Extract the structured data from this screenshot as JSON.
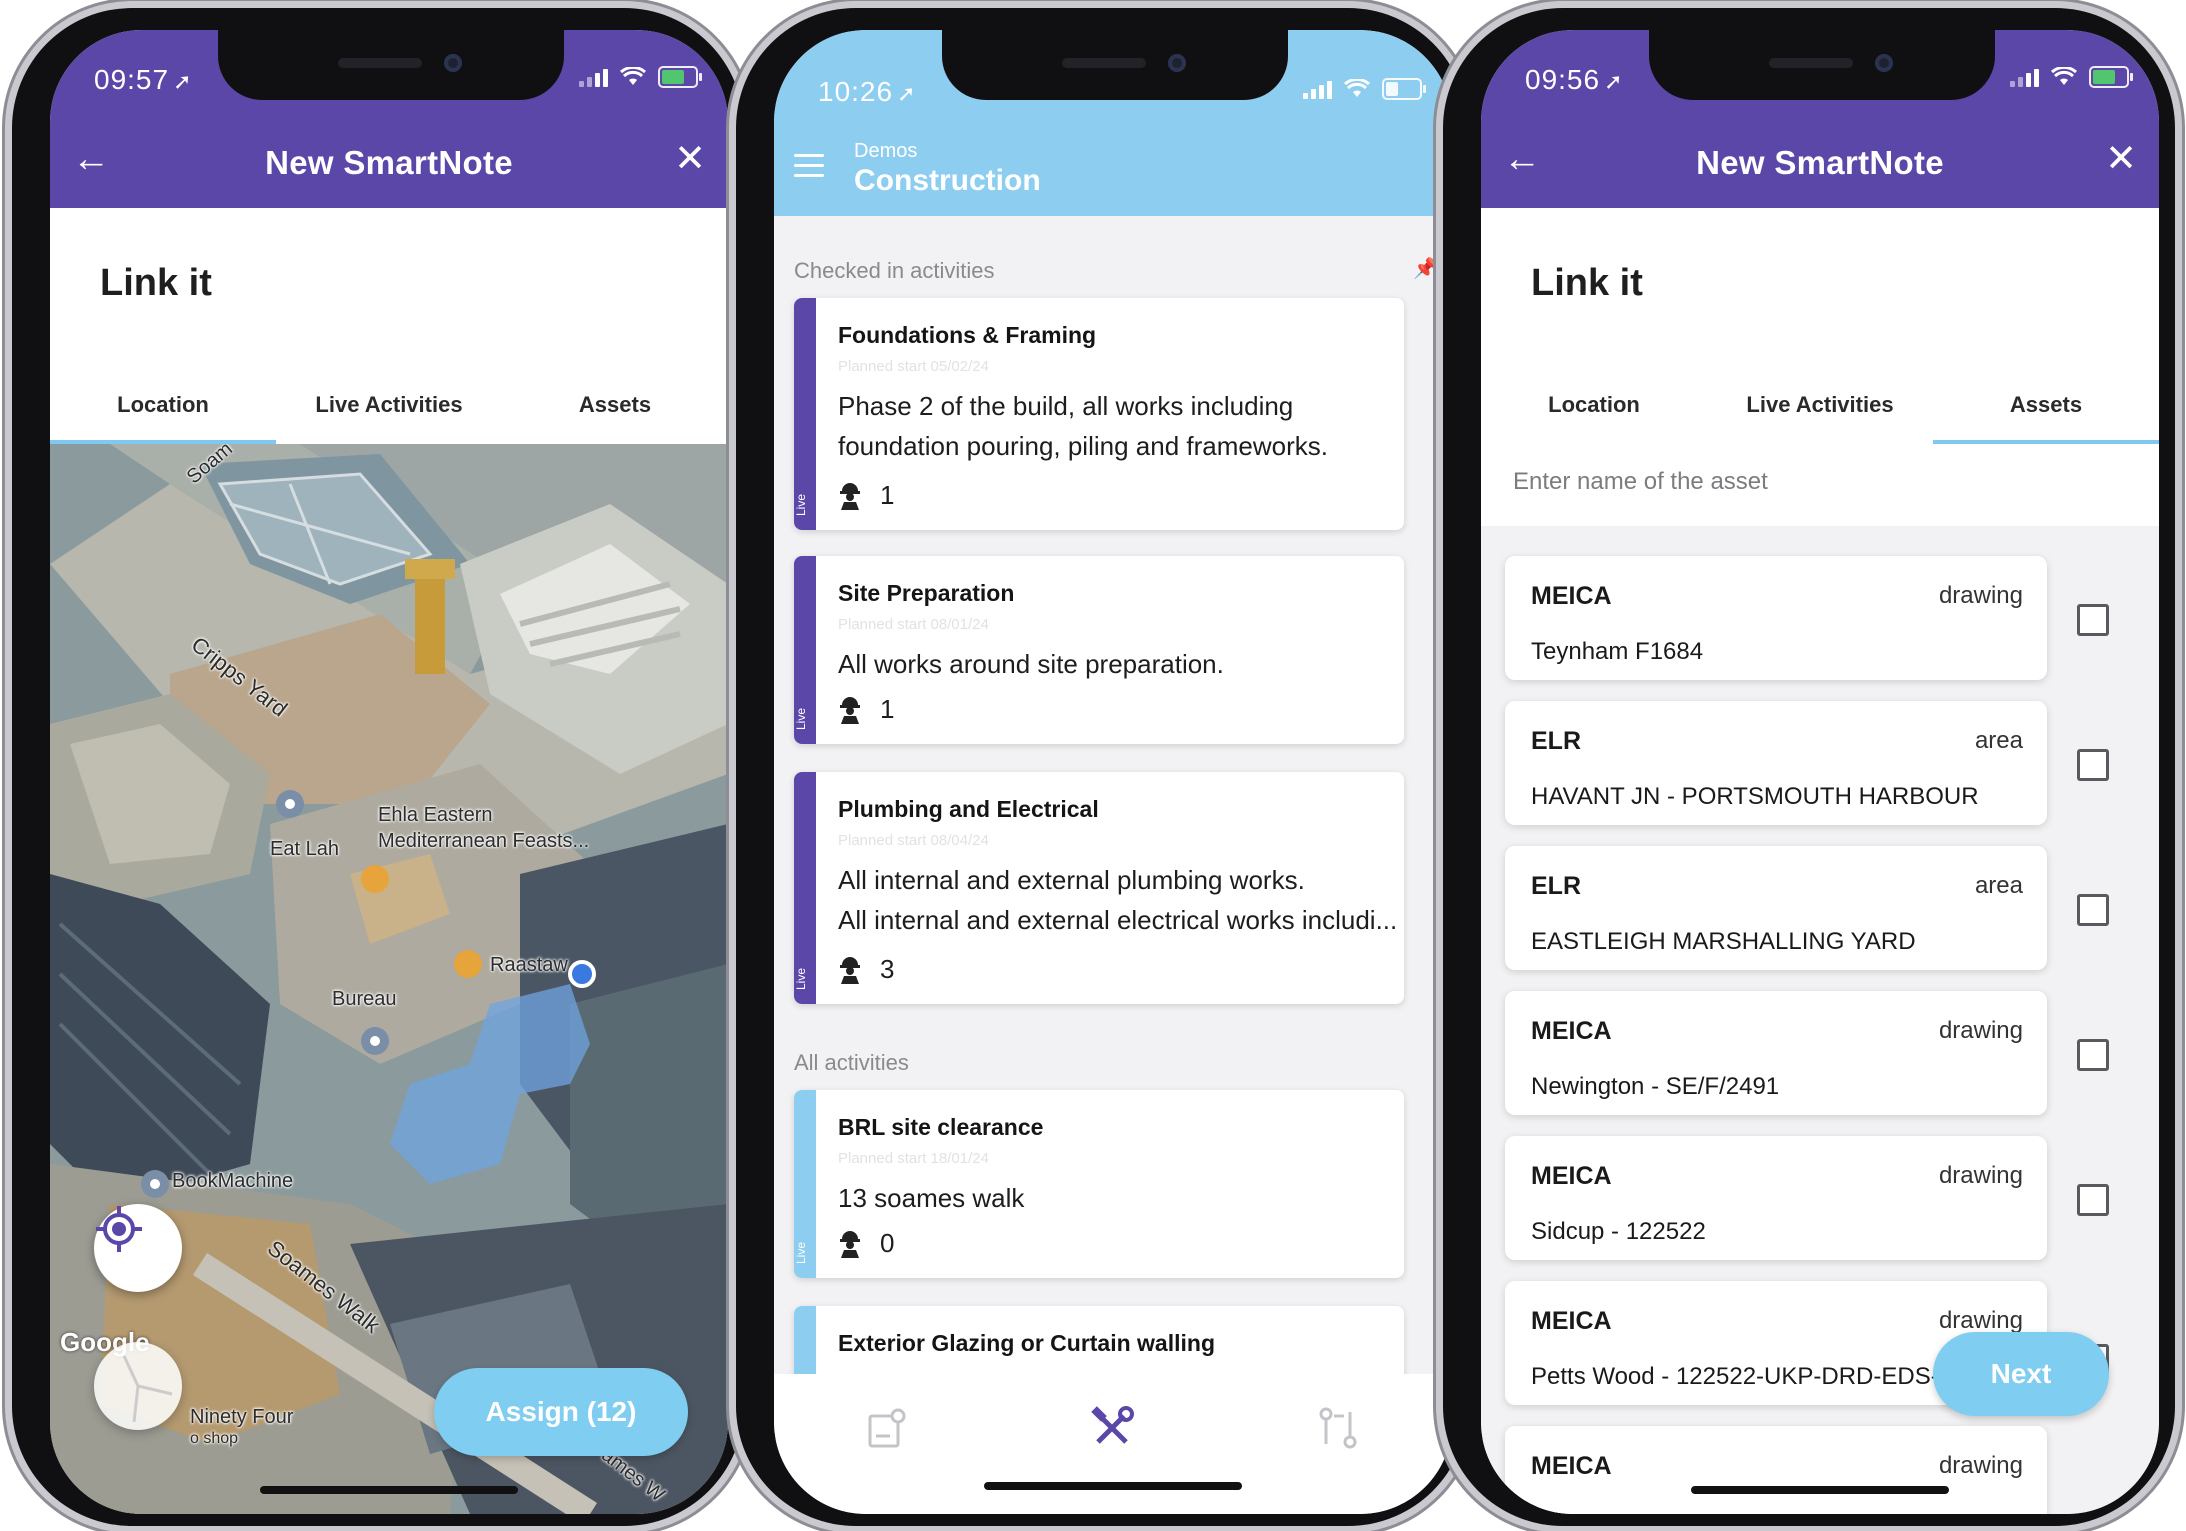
{
  "phone1": {
    "status": {
      "time": "09:57"
    },
    "header": {
      "title": "New SmartNote"
    },
    "heading": "Link it",
    "tabs": [
      "Location",
      "Live Activities",
      "Assets"
    ],
    "active_tab": "Location",
    "map": {
      "labels": [
        "Soam",
        "Cripps Yard",
        "Ehla Eastern",
        "Mediterranean Feasts...",
        "Eat Lah",
        "Raastaw",
        "Bureau",
        "BookMachine",
        "Soames Walk",
        "Ninety Four",
        "o shop",
        "ames W"
      ],
      "attribution": "Google"
    },
    "assign_button": "Assign (12)"
  },
  "phone2": {
    "status": {
      "time": "10:26"
    },
    "header": {
      "subtitle": "Demos",
      "title": "Construction"
    },
    "sections": {
      "checked_in": "Checked in activities",
      "all": "All activities"
    },
    "cards": [
      {
        "title": "Foundations & Framing",
        "planned": "Planned start 05/02/24",
        "desc1": "Phase 2 of the build, all works including",
        "desc2": "foundation pouring, piling and frameworks.",
        "count": "1",
        "tag": "Live"
      },
      {
        "title": "Site Preparation",
        "planned": "Planned start 08/01/24",
        "desc1": "All works around site preparation.",
        "count": "1",
        "tag": "Live"
      },
      {
        "title": "Plumbing and Electrical",
        "planned": "Planned start 08/04/24",
        "desc1": "All internal and external plumbing works.",
        "desc2": "All internal and external electrical works includi...",
        "count": "3",
        "tag": "Live"
      },
      {
        "title": "BRL site clearance",
        "planned": "Planned start 18/01/24",
        "desc1": "13 soames walk",
        "count": "0",
        "tag": "Live"
      },
      {
        "title": "Exterior Glazing or Curtain walling"
      }
    ],
    "nav_icons": [
      "notes-icon",
      "tools-icon",
      "workflow-icon"
    ]
  },
  "phone3": {
    "status": {
      "time": "09:56"
    },
    "header": {
      "title": "New SmartNote"
    },
    "heading": "Link it",
    "tabs": [
      "Location",
      "Live Activities",
      "Assets"
    ],
    "active_tab": "Assets",
    "search": {
      "placeholder": "Enter name of the asset"
    },
    "assets": [
      {
        "type": "MEICA",
        "kind": "drawing",
        "name": "Teynham F1684"
      },
      {
        "type": "ELR",
        "kind": "area",
        "name": "HAVANT JN - PORTSMOUTH HARBOUR"
      },
      {
        "type": "ELR",
        "kind": "area",
        "name": "EASTLEIGH MARSHALLING YARD"
      },
      {
        "type": "MEICA",
        "kind": "drawing",
        "name": "Newington -  SE/F/2491"
      },
      {
        "type": "MEICA",
        "kind": "drawing",
        "name": "Sidcup - 122522"
      },
      {
        "type": "MEICA",
        "kind": "drawing",
        "name": "Petts Wood - 122522-UKP-DRD-EDS-"
      },
      {
        "type": "MEICA",
        "kind": "drawing",
        "name": ""
      }
    ],
    "next_button": "Next"
  },
  "colors": {
    "purple": "#5b47a8",
    "light_blue": "#8dcdf0",
    "button_blue": "#7fcdf1"
  }
}
